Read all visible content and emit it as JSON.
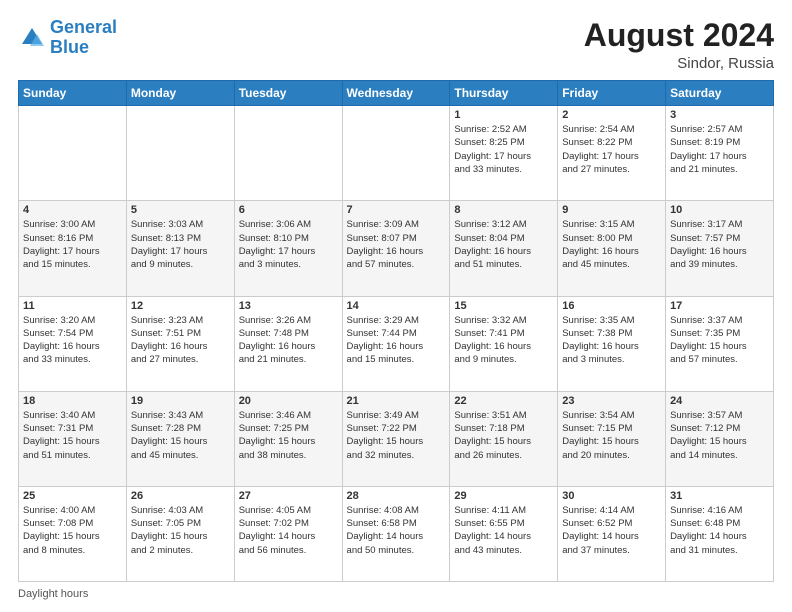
{
  "header": {
    "logo_line1": "General",
    "logo_line2": "Blue",
    "main_title": "August 2024",
    "subtitle": "Sindor, Russia"
  },
  "days_of_week": [
    "Sunday",
    "Monday",
    "Tuesday",
    "Wednesday",
    "Thursday",
    "Friday",
    "Saturday"
  ],
  "weeks": [
    [
      {
        "day": "",
        "info": ""
      },
      {
        "day": "",
        "info": ""
      },
      {
        "day": "",
        "info": ""
      },
      {
        "day": "",
        "info": ""
      },
      {
        "day": "1",
        "info": "Sunrise: 2:52 AM\nSunset: 8:25 PM\nDaylight: 17 hours\nand 33 minutes."
      },
      {
        "day": "2",
        "info": "Sunrise: 2:54 AM\nSunset: 8:22 PM\nDaylight: 17 hours\nand 27 minutes."
      },
      {
        "day": "3",
        "info": "Sunrise: 2:57 AM\nSunset: 8:19 PM\nDaylight: 17 hours\nand 21 minutes."
      }
    ],
    [
      {
        "day": "4",
        "info": "Sunrise: 3:00 AM\nSunset: 8:16 PM\nDaylight: 17 hours\nand 15 minutes."
      },
      {
        "day": "5",
        "info": "Sunrise: 3:03 AM\nSunset: 8:13 PM\nDaylight: 17 hours\nand 9 minutes."
      },
      {
        "day": "6",
        "info": "Sunrise: 3:06 AM\nSunset: 8:10 PM\nDaylight: 17 hours\nand 3 minutes."
      },
      {
        "day": "7",
        "info": "Sunrise: 3:09 AM\nSunset: 8:07 PM\nDaylight: 16 hours\nand 57 minutes."
      },
      {
        "day": "8",
        "info": "Sunrise: 3:12 AM\nSunset: 8:04 PM\nDaylight: 16 hours\nand 51 minutes."
      },
      {
        "day": "9",
        "info": "Sunrise: 3:15 AM\nSunset: 8:00 PM\nDaylight: 16 hours\nand 45 minutes."
      },
      {
        "day": "10",
        "info": "Sunrise: 3:17 AM\nSunset: 7:57 PM\nDaylight: 16 hours\nand 39 minutes."
      }
    ],
    [
      {
        "day": "11",
        "info": "Sunrise: 3:20 AM\nSunset: 7:54 PM\nDaylight: 16 hours\nand 33 minutes."
      },
      {
        "day": "12",
        "info": "Sunrise: 3:23 AM\nSunset: 7:51 PM\nDaylight: 16 hours\nand 27 minutes."
      },
      {
        "day": "13",
        "info": "Sunrise: 3:26 AM\nSunset: 7:48 PM\nDaylight: 16 hours\nand 21 minutes."
      },
      {
        "day": "14",
        "info": "Sunrise: 3:29 AM\nSunset: 7:44 PM\nDaylight: 16 hours\nand 15 minutes."
      },
      {
        "day": "15",
        "info": "Sunrise: 3:32 AM\nSunset: 7:41 PM\nDaylight: 16 hours\nand 9 minutes."
      },
      {
        "day": "16",
        "info": "Sunrise: 3:35 AM\nSunset: 7:38 PM\nDaylight: 16 hours\nand 3 minutes."
      },
      {
        "day": "17",
        "info": "Sunrise: 3:37 AM\nSunset: 7:35 PM\nDaylight: 15 hours\nand 57 minutes."
      }
    ],
    [
      {
        "day": "18",
        "info": "Sunrise: 3:40 AM\nSunset: 7:31 PM\nDaylight: 15 hours\nand 51 minutes."
      },
      {
        "day": "19",
        "info": "Sunrise: 3:43 AM\nSunset: 7:28 PM\nDaylight: 15 hours\nand 45 minutes."
      },
      {
        "day": "20",
        "info": "Sunrise: 3:46 AM\nSunset: 7:25 PM\nDaylight: 15 hours\nand 38 minutes."
      },
      {
        "day": "21",
        "info": "Sunrise: 3:49 AM\nSunset: 7:22 PM\nDaylight: 15 hours\nand 32 minutes."
      },
      {
        "day": "22",
        "info": "Sunrise: 3:51 AM\nSunset: 7:18 PM\nDaylight: 15 hours\nand 26 minutes."
      },
      {
        "day": "23",
        "info": "Sunrise: 3:54 AM\nSunset: 7:15 PM\nDaylight: 15 hours\nand 20 minutes."
      },
      {
        "day": "24",
        "info": "Sunrise: 3:57 AM\nSunset: 7:12 PM\nDaylight: 15 hours\nand 14 minutes."
      }
    ],
    [
      {
        "day": "25",
        "info": "Sunrise: 4:00 AM\nSunset: 7:08 PM\nDaylight: 15 hours\nand 8 minutes."
      },
      {
        "day": "26",
        "info": "Sunrise: 4:03 AM\nSunset: 7:05 PM\nDaylight: 15 hours\nand 2 minutes."
      },
      {
        "day": "27",
        "info": "Sunrise: 4:05 AM\nSunset: 7:02 PM\nDaylight: 14 hours\nand 56 minutes."
      },
      {
        "day": "28",
        "info": "Sunrise: 4:08 AM\nSunset: 6:58 PM\nDaylight: 14 hours\nand 50 minutes."
      },
      {
        "day": "29",
        "info": "Sunrise: 4:11 AM\nSunset: 6:55 PM\nDaylight: 14 hours\nand 43 minutes."
      },
      {
        "day": "30",
        "info": "Sunrise: 4:14 AM\nSunset: 6:52 PM\nDaylight: 14 hours\nand 37 minutes."
      },
      {
        "day": "31",
        "info": "Sunrise: 4:16 AM\nSunset: 6:48 PM\nDaylight: 14 hours\nand 31 minutes."
      }
    ]
  ],
  "footer": {
    "label": "Daylight hours"
  }
}
